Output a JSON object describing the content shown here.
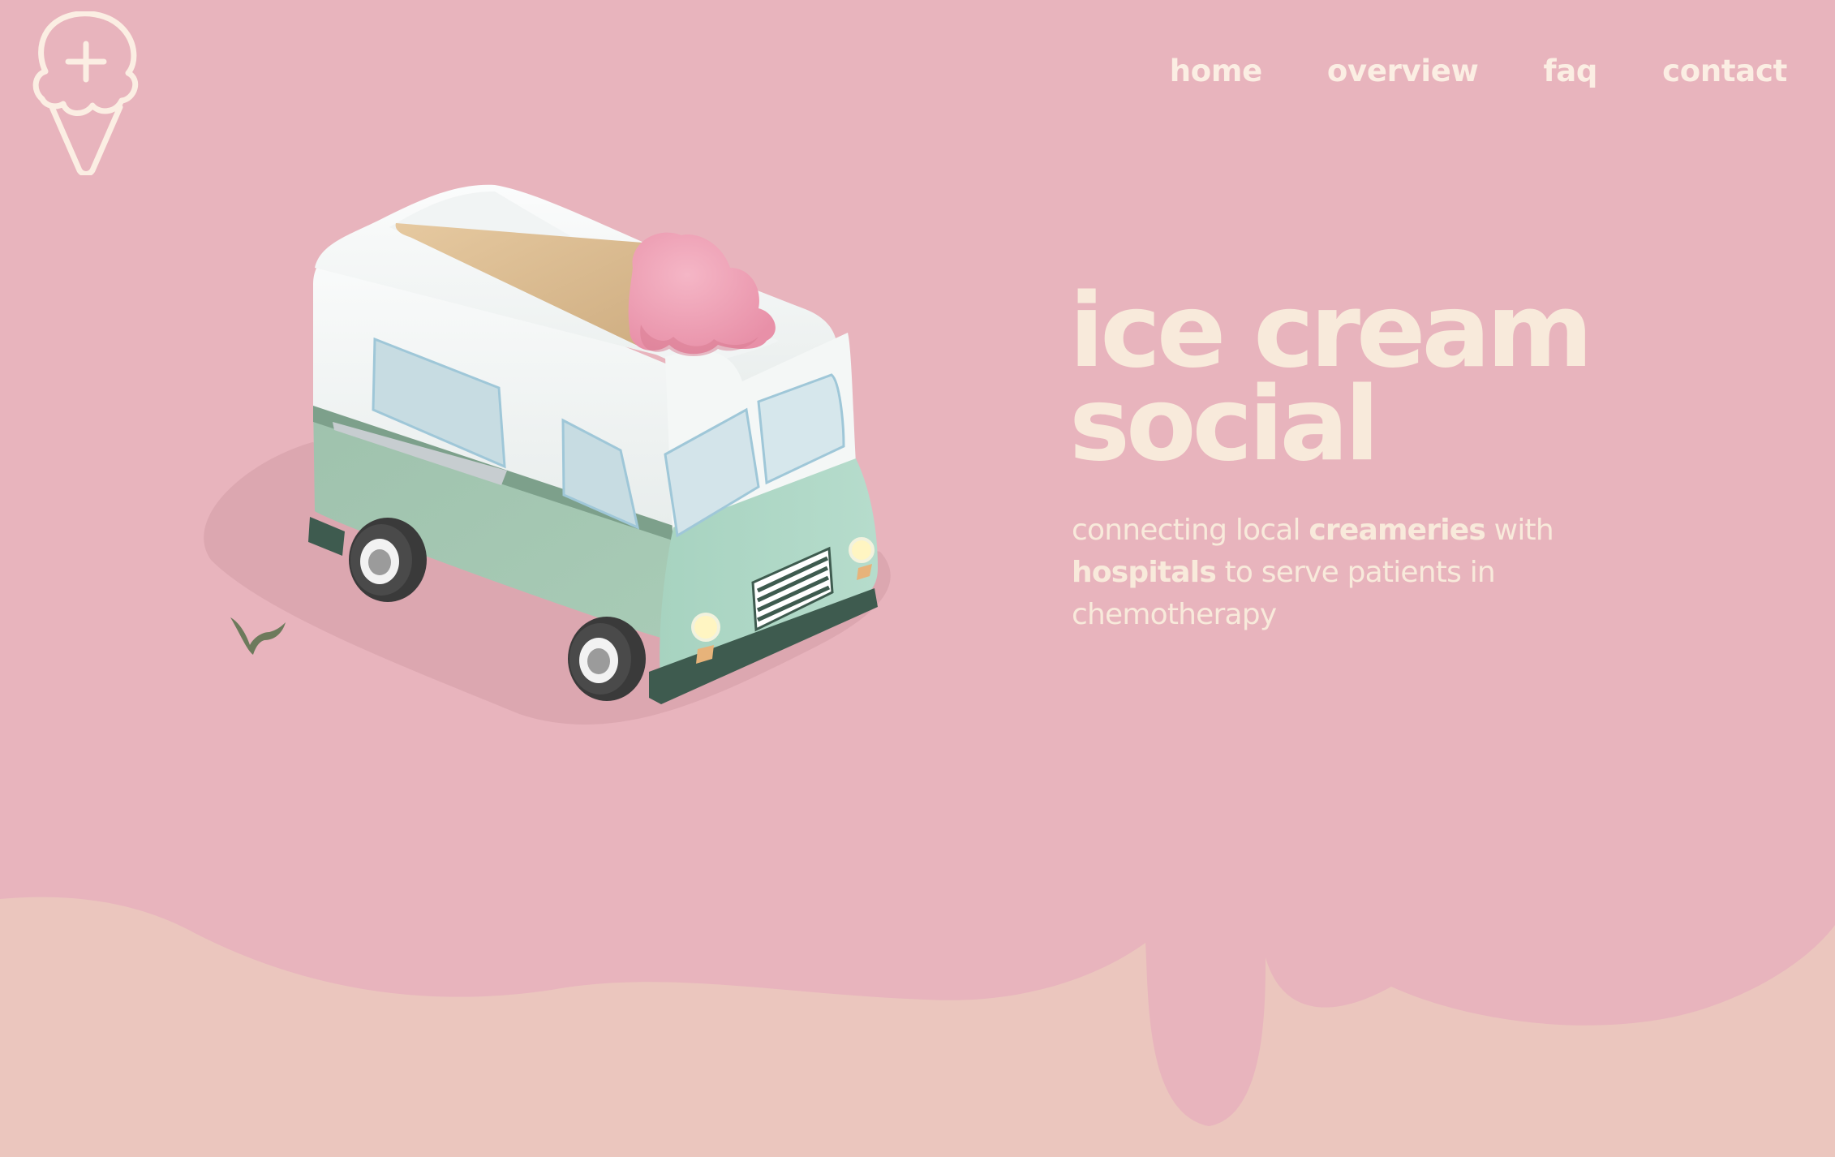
{
  "colors": {
    "background": "#e8b4bd",
    "drip_background": "#ebc6be",
    "text_cream": "#f8eadb",
    "truck_mint": "#a3c4b0",
    "truck_white": "#f4f6f6",
    "scoop_pink": "#ee9fb5",
    "cone_tan": "#d8bb92"
  },
  "logo": {
    "icon": "ice-cream-cone-plus-icon"
  },
  "nav": {
    "items": [
      {
        "label": "home"
      },
      {
        "label": "overview"
      },
      {
        "label": "faq"
      },
      {
        "label": "contact"
      }
    ]
  },
  "hero": {
    "title_line1": "ice cream",
    "title_line2": "social",
    "tagline": {
      "part1": "connecting local ",
      "bold1": "creameries",
      "part2": " with ",
      "bold2": "hospitals",
      "part3": " to serve patients in chemotherapy"
    }
  },
  "illustration": {
    "subject": "ice-cream-truck-icon",
    "accent": "bird-icon"
  }
}
